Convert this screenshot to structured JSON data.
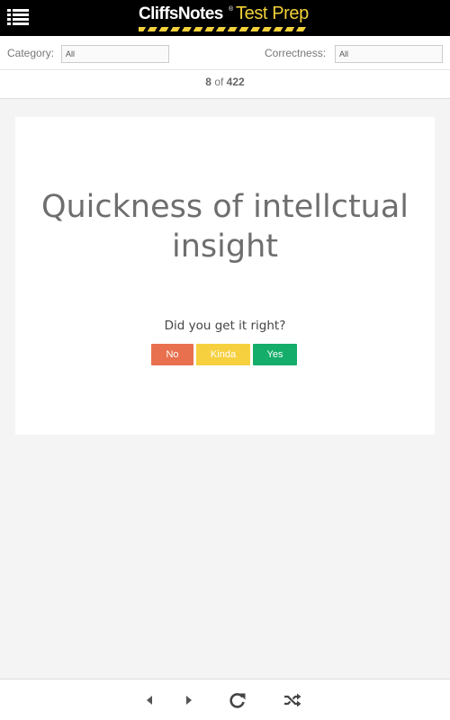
{
  "header": {
    "menu_icon": "list-menu-icon",
    "logo_primary": "CliffsNotes",
    "logo_registered": "®",
    "logo_secondary": "Test Prep",
    "accent_color": "#f3d23b"
  },
  "filters": {
    "category_label": "Category:",
    "category_value": "All",
    "correctness_label": "Correctness:",
    "correctness_value": "All"
  },
  "counter": {
    "current": "8",
    "separator": "of",
    "total": "422"
  },
  "card": {
    "term": "Quickness of intellctual insight",
    "prompt": "Did you get it right?",
    "buttons": {
      "no": "No",
      "kinda": "Kinda",
      "yes": "Yes"
    },
    "button_colors": {
      "no": "#e8704e",
      "kinda": "#f6d03f",
      "yes": "#14ad6a"
    }
  },
  "toolbar": {
    "icons": [
      "previous-icon",
      "next-icon",
      "refresh-icon",
      "shuffle-icon"
    ]
  }
}
